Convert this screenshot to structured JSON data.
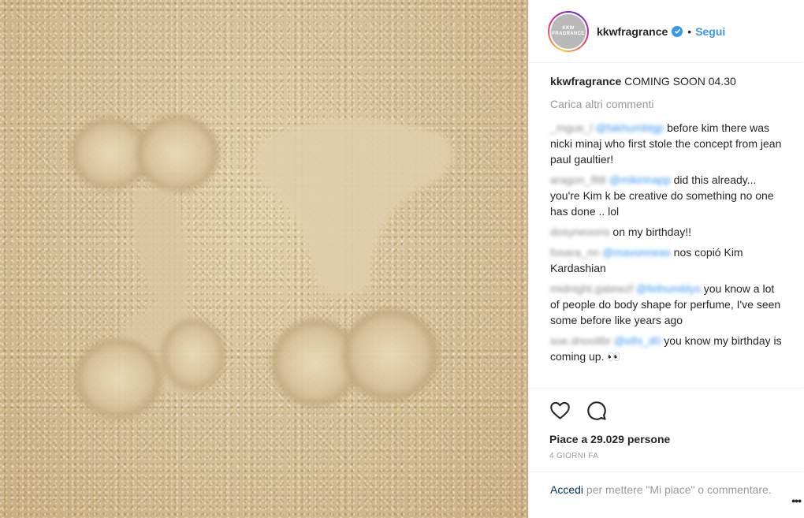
{
  "post": {
    "username": "kkwfragrance",
    "avatar_text": [
      "KKW",
      "FRAGRANCE"
    ],
    "follow_label": "Segui",
    "separator": "•",
    "caption": "COMING SOON 04.30",
    "load_more": "Carica altri commenti",
    "comments": [
      {
        "user": "_mgue_l",
        "tag": "@fakhumblgp",
        "text": "before kim there was nicki minaj who first stole the concept from jean paul gaultier!"
      },
      {
        "user": "aragon_f88",
        "tag": "@mikirinapp",
        "text": "did this already... you're Kim k be creative do something no one has done .. lol"
      },
      {
        "user": "dosyneoons",
        "tag": "",
        "text": "on my birthday!!"
      },
      {
        "user": "fosara_nn",
        "tag": "@mavonneas",
        "text": "nos copió Kim Kardashian"
      },
      {
        "user": "midnight.gatewzf",
        "tag": "@fethumblys",
        "text": "you know a lot of people do body shape for perfume, I've seen some before like years ago"
      },
      {
        "user": "soe.dnooltbr",
        "tag": "@elhi_d0",
        "text": "you know my birthday is coming up. 👀"
      }
    ],
    "likes": "Piace a 29.029 persone",
    "time_ago": "4 giorni fa",
    "login_link": "Accedi",
    "login_text": " per mettere \"Mi piace\" o commentare.",
    "more_label": "•••"
  },
  "icons": {
    "like": "heart-icon",
    "comment": "speech-bubble-icon",
    "verified": "verified-badge-icon"
  },
  "colors": {
    "accent": "#3897f0",
    "link_dark": "#003569",
    "muted": "#999999",
    "sand": "#d9c29a"
  }
}
